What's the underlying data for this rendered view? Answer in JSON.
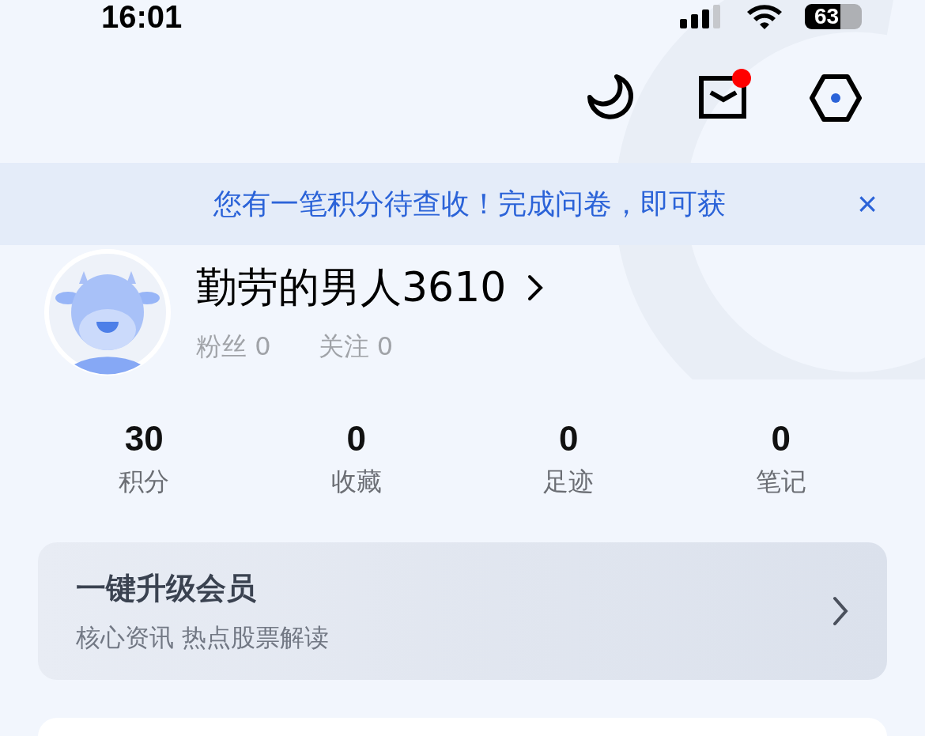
{
  "status_bar": {
    "time": "16:01",
    "battery": "63"
  },
  "top_actions": {
    "mail_unread": true
  },
  "notice": {
    "text": "您有一笔积分待查收！完成问卷，即可获",
    "close": "×"
  },
  "profile": {
    "name": "勤劳的男人3610",
    "followers_label": "粉丝",
    "followers": "0",
    "following_label": "关注",
    "following": "0"
  },
  "stats": [
    {
      "value": "30",
      "label": "积分"
    },
    {
      "value": "0",
      "label": "收藏"
    },
    {
      "value": "0",
      "label": "足迹"
    },
    {
      "value": "0",
      "label": "笔记"
    }
  ],
  "vip_card": {
    "title": "一键升级会员",
    "subtitle": "核心资讯 热点股票解读"
  }
}
